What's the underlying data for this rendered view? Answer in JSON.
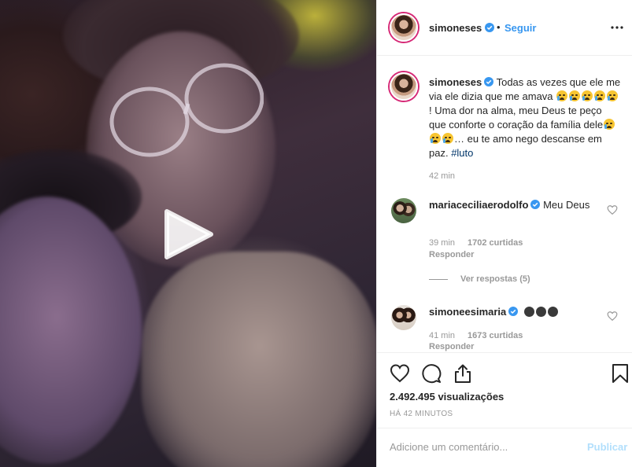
{
  "post": {
    "author": "simoneses",
    "follow_label": "Seguir",
    "separator": "•",
    "caption": {
      "text_1": "Todas as vezes que ele me via ele dizia que me amava ",
      "text_2": "! Uma dor na alma, meu Deus te peço que conforte o coração da família dele",
      "text_3": "… eu te amo nego descanse em paz. ",
      "hashtag": "#luto",
      "time": "42 min"
    },
    "comments": [
      {
        "username": "maria​ceciliaerodolfo",
        "text": "Meu Deus",
        "time": "39 min",
        "likes": "1702 curtidas",
        "reply_label": "Responder",
        "view_replies": "Ver respostas (5)"
      },
      {
        "username": "simoneesimaria",
        "text": "",
        "time": "41 min",
        "likes": "1673 curtidas",
        "reply_label": "Responder"
      }
    ],
    "views": "2.492.495 visualizações",
    "posted_ago": "HÁ 42 MINUTOS",
    "comment_placeholder": "Adicione um comentário...",
    "publish_label": "Publicar"
  },
  "icons": {
    "more": "more-options-icon",
    "like": "heart-icon",
    "comment": "comment-bubble-icon",
    "share": "share-icon",
    "save": "bookmark-icon",
    "play": "play-icon",
    "verified": "verified-badge-icon"
  },
  "colors": {
    "accent_blue": "#3897f0",
    "verified_blue": "#3897f0",
    "muted_text": "#999999",
    "publish_disabled": "#b2dffc"
  }
}
